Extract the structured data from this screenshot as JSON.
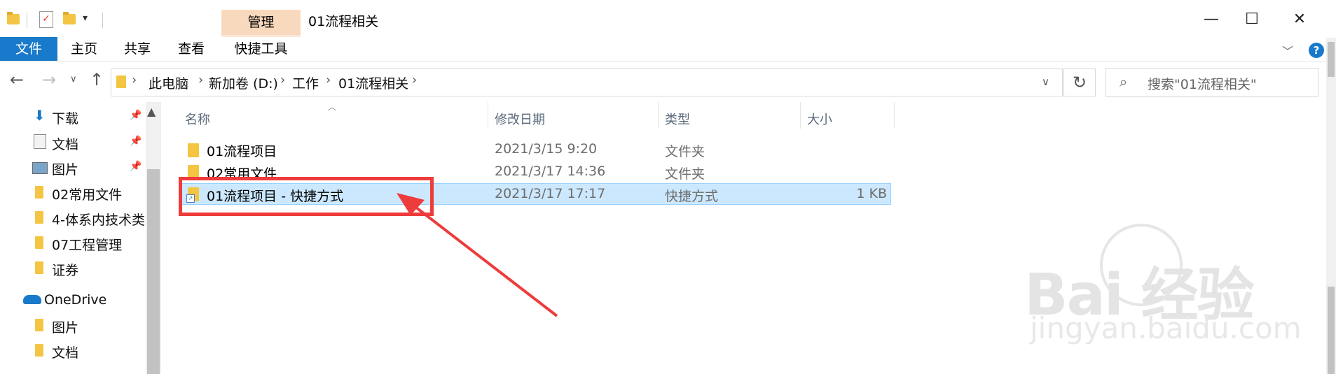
{
  "window": {
    "title": "01流程相关",
    "tools_tab_head": "管理",
    "controls": [
      "—",
      "☐",
      "✕"
    ]
  },
  "ribbon": {
    "tabs": [
      "文件",
      "主页",
      "共享",
      "查看",
      "快捷工具"
    ],
    "help": "?"
  },
  "address": {
    "crumbs": [
      "此电脑",
      "新加卷 (D:)",
      "工作",
      "01流程相关"
    ],
    "search_placeholder": "搜索\"01流程相关\""
  },
  "nav": {
    "quick_access": [
      {
        "label": "下载",
        "icon": "download-icon",
        "pinned": true
      },
      {
        "label": "文档",
        "icon": "document-icon",
        "pinned": true
      },
      {
        "label": "图片",
        "icon": "picture-icon",
        "pinned": true
      },
      {
        "label": "02常用文件",
        "icon": "folder-icon",
        "pinned": false
      },
      {
        "label": "4-体系内技术类",
        "icon": "folder-icon",
        "pinned": false
      },
      {
        "label": "07工程管理",
        "icon": "folder-icon",
        "pinned": false
      },
      {
        "label": "证券",
        "icon": "folder-icon",
        "pinned": false
      }
    ],
    "onedrive": {
      "label": "OneDrive",
      "children": [
        "图片",
        "文档"
      ]
    }
  },
  "table": {
    "columns": [
      "名称",
      "修改日期",
      "类型",
      "大小"
    ],
    "rows": [
      {
        "name": "01流程项目",
        "date": "2021/3/15 9:20",
        "type": "文件夹",
        "size": "",
        "selected": false
      },
      {
        "name": "02常用文件",
        "date": "2021/3/17 14:36",
        "type": "文件夹",
        "size": "",
        "selected": false
      },
      {
        "name": "01流程项目 - 快捷方式",
        "date": "2021/3/17 17:17",
        "type": "快捷方式",
        "size": "1 KB",
        "selected": true
      }
    ]
  },
  "watermark": {
    "brand": "Bai 经验",
    "sub": "jingyan.baidu.com"
  },
  "colors": {
    "accent": "#1979ca",
    "selection": "#cce8ff",
    "highlight": "#ee3b3b",
    "tools_tab": "#f9d9bd"
  }
}
